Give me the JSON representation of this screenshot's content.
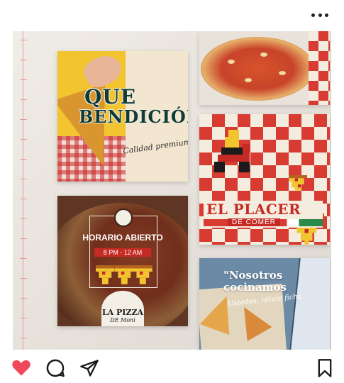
{
  "post_header": {
    "more_icon": "more-dots-icon"
  },
  "cards": {
    "que_bendicion": {
      "line1": "QUE",
      "line2": "BENDICIÓN",
      "script": "Calidad premium"
    },
    "pizza_photo": {},
    "el_placer": {
      "title": "EL PLACER",
      "subtitle": "DE COMER"
    },
    "horario": {
      "label": "HORARIO ABIERTO",
      "hours": "8 PM - 12 AM",
      "brand": "LA PIZZA",
      "brand_sub": "DE Moni"
    },
    "nosotros": {
      "line1": "\"Nosotros",
      "line2": "cocinamos",
      "script": "Ustedes, rétale ficha"
    }
  },
  "actions": {
    "like_icon": "heart-icon",
    "comment_icon": "comment-icon",
    "share_icon": "send-icon",
    "save_icon": "bookmark-icon"
  },
  "colors": {
    "like": "#f0485a",
    "brand_red": "#d73b32",
    "teal": "#0e3b36",
    "yellow": "#f2c530"
  }
}
